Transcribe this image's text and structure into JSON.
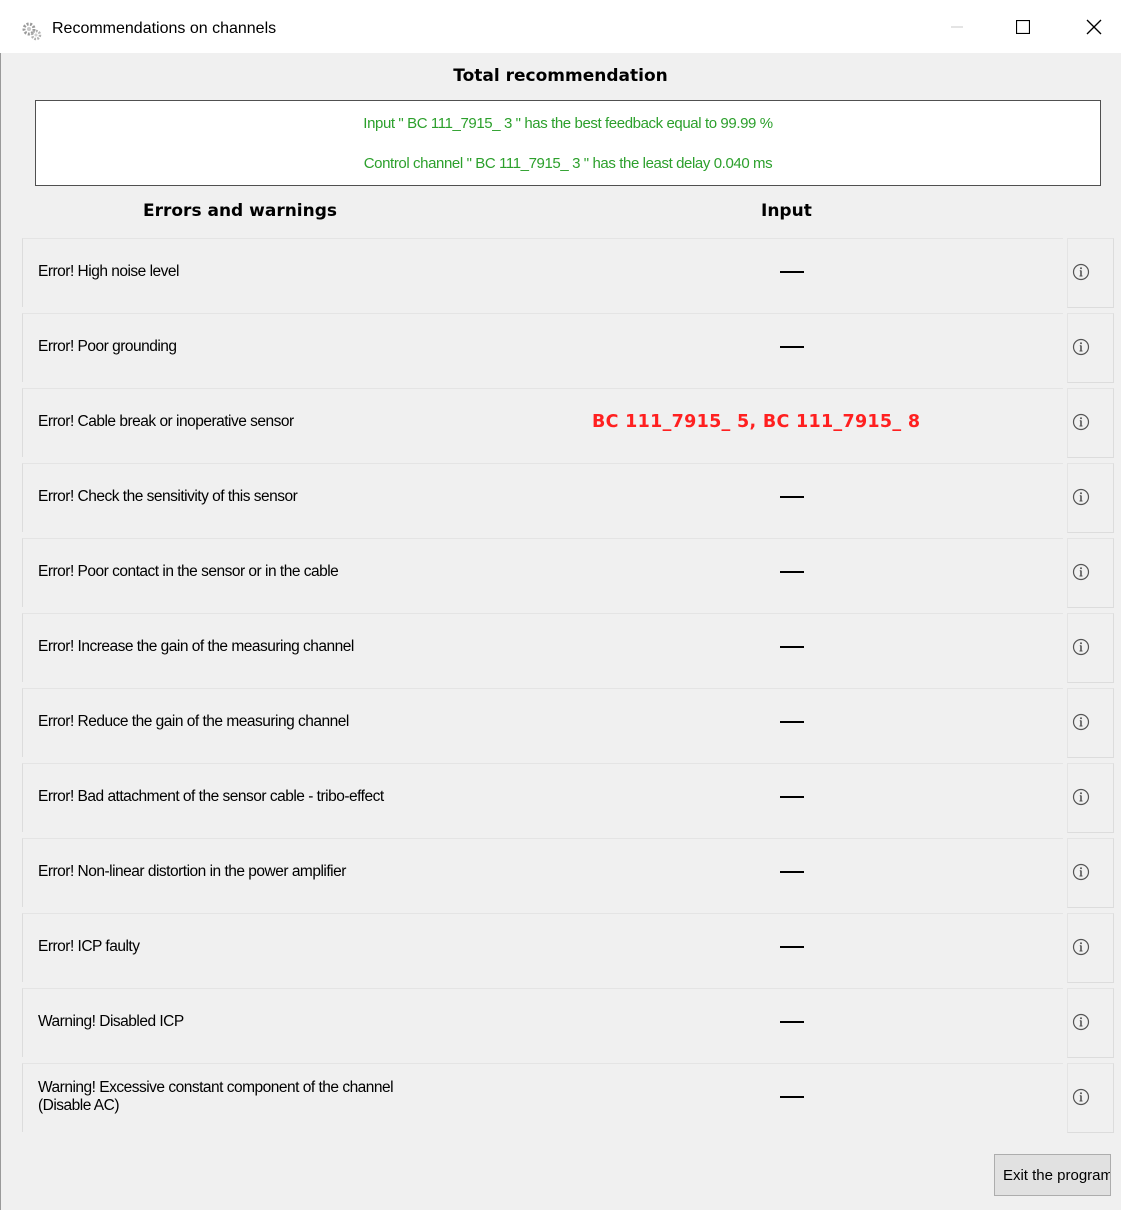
{
  "window": {
    "title": "Recommendations on channels",
    "icon": "gears-icon",
    "controls": [
      "minimize-icon",
      "maximize-icon",
      "close-icon"
    ]
  },
  "total": {
    "heading": "Total  recommendation",
    "line1": "Input \" BC 111_7915_ 3 \" has the best feedback equal to  99.99 %",
    "line2": "Control channel \" BC 111_7915_ 3 \" has the least delay  0.040 ms",
    "color": "#2ca02c"
  },
  "columns": {
    "errors": "Errors and warnings",
    "input": "Input"
  },
  "rows": [
    {
      "label": "Error! High noise level",
      "value": "—",
      "error": false
    },
    {
      "label": "Error! Poor grounding",
      "value": "—",
      "error": false
    },
    {
      "label": "Error! Cable break or inoperative sensor",
      "value": "BC 111_7915_ 5,  BC 111_7915_ 8",
      "error": true
    },
    {
      "label": "Error! Check the sensitivity of this sensor",
      "value": "—",
      "error": false
    },
    {
      "label": "Error! Poor contact in the sensor or in the cable",
      "value": "—",
      "error": false
    },
    {
      "label": "Error! Increase the gain of the measuring channel",
      "value": "—",
      "error": false
    },
    {
      "label": "Error! Reduce the gain of the measuring channel",
      "value": "—",
      "error": false
    },
    {
      "label": "Error! Bad attachment of the sensor cable - tribo-effect",
      "value": "—",
      "error": false
    },
    {
      "label": "Error! Non-linear distortion in the power amplifier",
      "value": "—",
      "error": false
    },
    {
      "label": "Error! ICP faulty",
      "value": "—",
      "error": false
    },
    {
      "label": "Warning! Disabled ICP",
      "value": "—",
      "error": false
    },
    {
      "label": "Warning! Excessive constant component of the channel\n(Disable AC)",
      "value": "—",
      "error": false
    }
  ],
  "info_icon": "info-circle-icon",
  "error_color": "#ff2020",
  "exit_button": "Exit the program"
}
